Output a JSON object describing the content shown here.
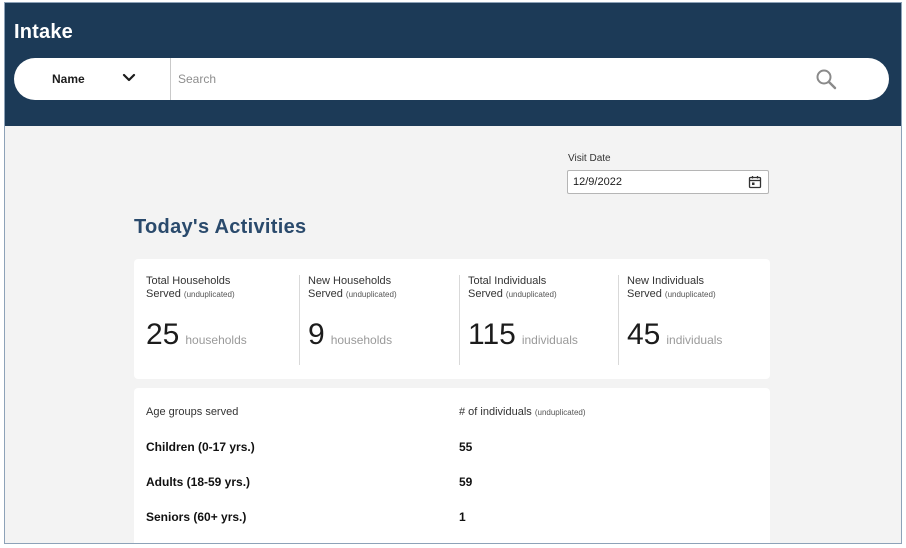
{
  "app": {
    "title": "Intake"
  },
  "search": {
    "field_selected": "Name",
    "placeholder": "Search",
    "value": "",
    "chevron_icon": "chevron-down-icon",
    "search_icon": "search-icon"
  },
  "visit": {
    "label": "Visit Date",
    "date": "12/9/2022",
    "calendar_icon": "calendar-icon"
  },
  "activities": {
    "title": "Today's Activities",
    "stats": [
      {
        "line1": "Total Households",
        "line2": "Served",
        "note": "(unduplicated)",
        "value": "25",
        "unit": "households"
      },
      {
        "line1": "New Households",
        "line2": "Served",
        "note": "(unduplicated)",
        "value": "9",
        "unit": "households"
      },
      {
        "line1": "Total Individuals",
        "line2": "Served",
        "note": "(unduplicated)",
        "value": "115",
        "unit": "individuals"
      },
      {
        "line1": "New Individuals",
        "line2": "Served",
        "note": "(unduplicated)",
        "value": "45",
        "unit": "individuals"
      }
    ]
  },
  "ages": {
    "header_label": "Age groups served",
    "header_value": "# of individuals",
    "header_value_note": "(unduplicated)",
    "rows": [
      {
        "label": "Children (0-17 yrs.)",
        "value": "55"
      },
      {
        "label": "Adults (18-59 yrs.)",
        "value": "59"
      },
      {
        "label": "Seniors (60+ yrs.)",
        "value": "1"
      }
    ]
  },
  "colors": {
    "header_bg": "#1c3a57",
    "title_accent": "#2a4a6c",
    "page_bg": "#f3f3f3"
  }
}
